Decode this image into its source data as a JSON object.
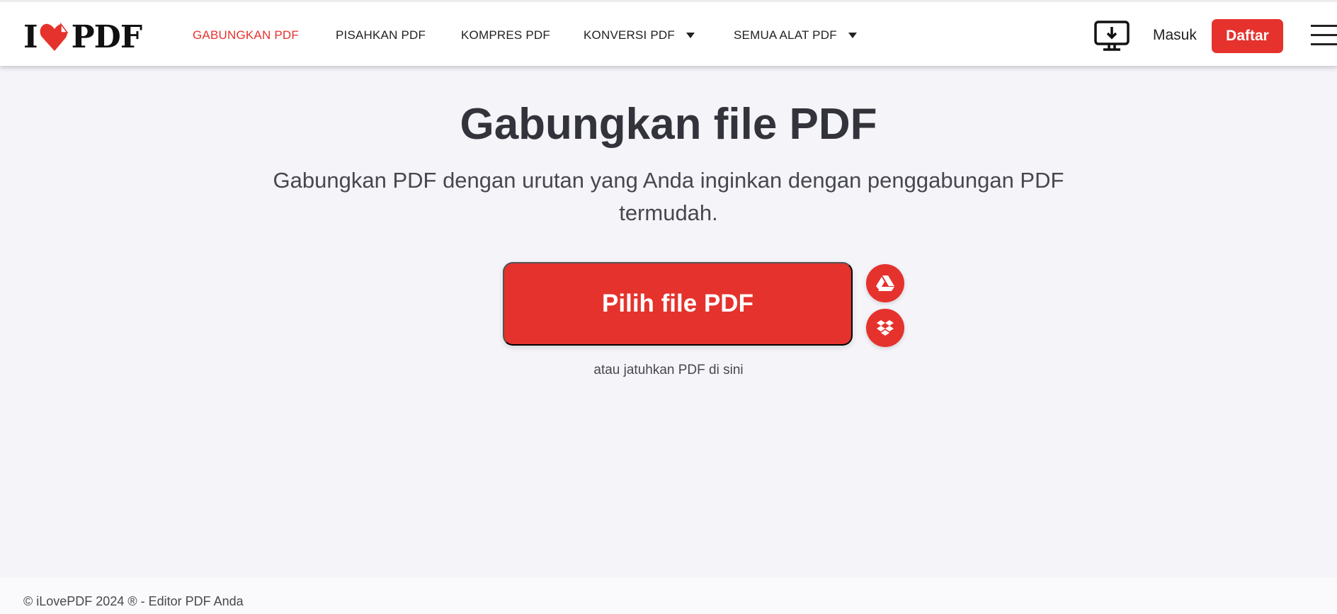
{
  "header": {
    "logo_text_left": "I",
    "logo_text_right": "PDF",
    "nav": [
      {
        "label": "GABUNGKAN PDF",
        "active": true
      },
      {
        "label": "PISAHKAN PDF"
      },
      {
        "label": "KOMPRES PDF"
      },
      {
        "label": "KONVERSI PDF",
        "dropdown": true
      },
      {
        "label": "SEMUA ALAT PDF",
        "dropdown": true
      }
    ],
    "login_label": "Masuk",
    "signup_label": "Daftar"
  },
  "main": {
    "title": "Gabungkan file PDF",
    "subtitle": "Gabungkan PDF dengan urutan yang Anda inginkan dengan penggabungan PDF termudah.",
    "select_button": "Pilih file PDF",
    "drop_hint": "atau jatuhkan PDF di sini",
    "icons": [
      "google-drive-icon",
      "dropbox-icon"
    ]
  },
  "footer": {
    "text": "© iLovePDF 2024 ® - Editor PDF Anda"
  },
  "colors": {
    "brand": "#e5322d",
    "background": "#f4f4f9"
  }
}
